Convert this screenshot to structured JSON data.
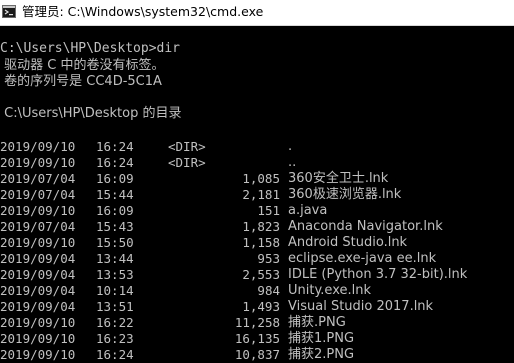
{
  "window": {
    "title": "管理员: C:\\Windows\\system32\\cmd.exe",
    "icon": "cmd-icon"
  },
  "console": {
    "prompt_command": "C:\\Users\\HP\\Desktop>dir",
    "volume_line": " 驱动器 C 中的卷没有标签。",
    "serial_line": " 卷的序列号是 CC4D-5C1A",
    "dir_of_line": " C:\\Users\\HP\\Desktop 的目录",
    "entries": [
      {
        "date": "2019/09/10",
        "time": "16:24",
        "dir": "<DIR>",
        "size": "",
        "name": "."
      },
      {
        "date": "2019/09/10",
        "time": "16:24",
        "dir": "<DIR>",
        "size": "",
        "name": ".."
      },
      {
        "date": "2019/07/04",
        "time": "16:09",
        "dir": "",
        "size": "1,085",
        "name": "360安全卫士.lnk"
      },
      {
        "date": "2019/07/04",
        "time": "15:44",
        "dir": "",
        "size": "2,181",
        "name": "360极速浏览器.lnk"
      },
      {
        "date": "2019/09/10",
        "time": "16:09",
        "dir": "",
        "size": "151",
        "name": "a.java"
      },
      {
        "date": "2019/07/04",
        "time": "15:43",
        "dir": "",
        "size": "1,823",
        "name": "Anaconda Navigator.lnk"
      },
      {
        "date": "2019/09/10",
        "time": "15:50",
        "dir": "",
        "size": "1,158",
        "name": "Android Studio.lnk"
      },
      {
        "date": "2019/09/04",
        "time": "13:44",
        "dir": "",
        "size": "953",
        "name": "eclipse.exe-java ee.lnk"
      },
      {
        "date": "2019/09/04",
        "time": "13:53",
        "dir": "",
        "size": "2,553",
        "name": "IDLE (Python 3.7 32-bit).lnk"
      },
      {
        "date": "2019/09/04",
        "time": "10:14",
        "dir": "",
        "size": "984",
        "name": "Unity.exe.lnk"
      },
      {
        "date": "2019/09/04",
        "time": "13:51",
        "dir": "",
        "size": "1,493",
        "name": "Visual Studio 2017.lnk"
      },
      {
        "date": "2019/09/10",
        "time": "16:22",
        "dir": "",
        "size": "11,258",
        "name": "捕获.PNG"
      },
      {
        "date": "2019/09/10",
        "time": "16:23",
        "dir": "",
        "size": "16,135",
        "name": "捕获1.PNG"
      },
      {
        "date": "2019/09/10",
        "time": "16:24",
        "dir": "",
        "size": "10,837",
        "name": "捕获2.PNG"
      }
    ]
  },
  "colors": {
    "background": "#000000",
    "text": "#c0c0c0",
    "titlebar": "#ffffff"
  }
}
